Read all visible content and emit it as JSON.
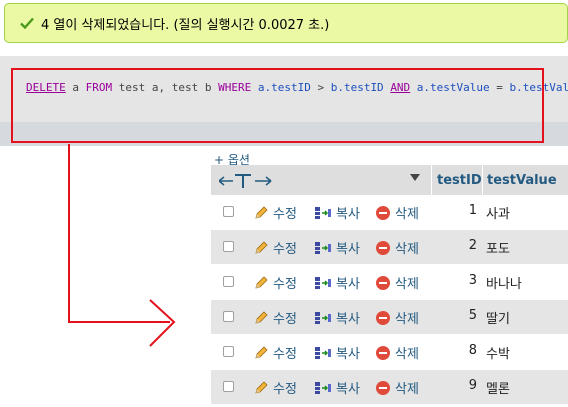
{
  "message": {
    "text": "4 열이 삭제되었습니다. (질의 실행시간 0.0027 초.)"
  },
  "sql": {
    "delete": "DELETE",
    "a": " a ",
    "from": "FROM",
    "tables": " test a, test b ",
    "where": "WHERE",
    "cond1_field": " a.testID",
    "gt": " > ",
    "cond1_field2": "b.testID",
    "space1": " ",
    "and": "AND",
    "cond2_field": " a.testValue",
    "eq": " = ",
    "cond2_field2": "b.testValue"
  },
  "options_label": "+ 옵션",
  "columns": {
    "id": "testID",
    "value": "testValue"
  },
  "actions": {
    "edit": "수정",
    "copy": "복사",
    "delete": "삭제"
  },
  "rows": [
    {
      "id": "1",
      "value": "사과"
    },
    {
      "id": "2",
      "value": "포도"
    },
    {
      "id": "3",
      "value": "바나나"
    },
    {
      "id": "5",
      "value": "딸기"
    },
    {
      "id": "8",
      "value": "수박"
    },
    {
      "id": "9",
      "value": "멜론"
    }
  ],
  "colors": {
    "accent": "#235a81",
    "annotation": "#e3111b",
    "success_bg": "#ebf8a4"
  }
}
